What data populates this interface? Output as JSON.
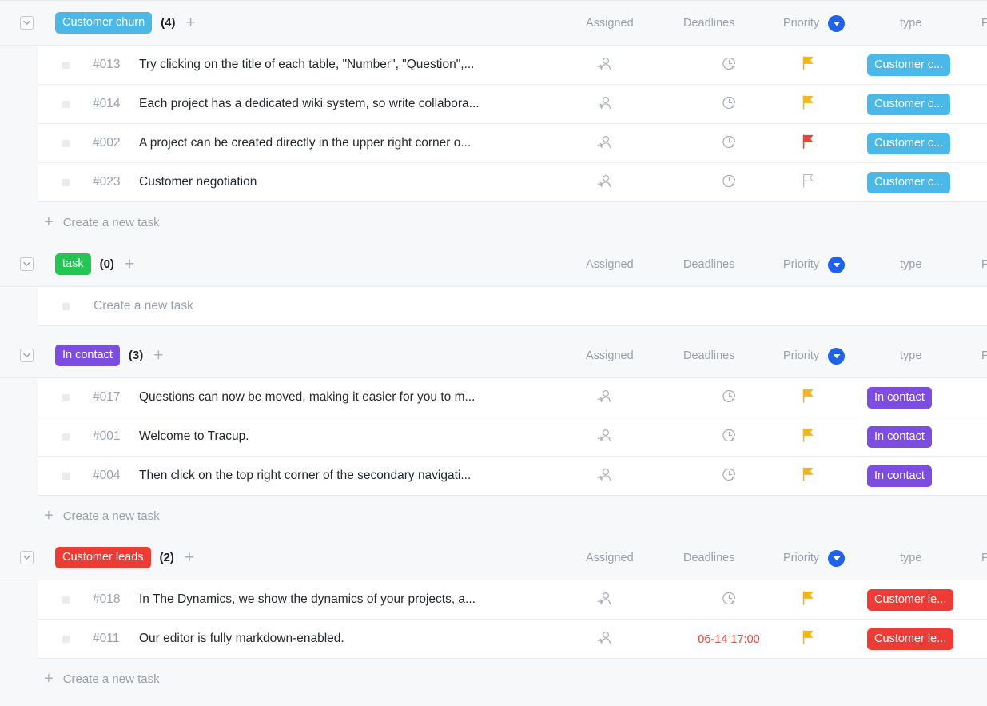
{
  "columns": {
    "assigned": "Assigned",
    "deadlines": "Deadlines",
    "priority": "Priority",
    "type": "type",
    "partial": "Pa"
  },
  "labels": {
    "create_task": "Create a new task",
    "create_task_placeholder": "Create a new task",
    "add_group_task": "+"
  },
  "colors": {
    "customer_churn": "#4cb8e8",
    "task": "#23c653",
    "in_contact": "#7c4dde",
    "customer_leads": "#ef3b36",
    "sort_indicator": "#1f62e8",
    "flag_high": "#efb61e",
    "flag_urgent": "#e8443a",
    "flag_none": "#b9bec8",
    "overdue_text": "#e8443a"
  },
  "groups": [
    {
      "name": "Customer churn",
      "badge_color": "#4cb8e8",
      "count": "(4)",
      "collapsed": false,
      "has_create_row": true,
      "tasks": [
        {
          "id": "#013",
          "title": "Try clicking on the title of each table, \"Number\", \"Question\",...",
          "assigned": "",
          "deadline": "",
          "priority": "high",
          "type": "Customer c..."
        },
        {
          "id": "#014",
          "title": "Each project has a dedicated wiki system, so write collabora...",
          "assigned": "",
          "deadline": "",
          "priority": "high",
          "type": "Customer c..."
        },
        {
          "id": "#002",
          "title": "A project can be created directly in the upper right corner o...",
          "assigned": "",
          "deadline": "",
          "priority": "urgent",
          "type": "Customer c..."
        },
        {
          "id": "#023",
          "title": "Customer negotiation",
          "assigned": "",
          "deadline": "",
          "priority": "none",
          "type": "Customer c..."
        }
      ]
    },
    {
      "name": "task",
      "badge_color": "#23c653",
      "count": "(0)",
      "collapsed": false,
      "has_create_row": false,
      "tasks": []
    },
    {
      "name": "In contact",
      "badge_color": "#7c4dde",
      "count": "(3)",
      "collapsed": false,
      "has_create_row": true,
      "tasks": [
        {
          "id": "#017",
          "title": "Questions can now be moved, making it easier for you to m...",
          "assigned": "",
          "deadline": "",
          "priority": "high",
          "type": "In contact"
        },
        {
          "id": "#001",
          "title": "Welcome to Tracup.",
          "assigned": "",
          "deadline": "",
          "priority": "high",
          "type": "In contact"
        },
        {
          "id": "#004",
          "title": "Then click on the top right corner of the secondary navigati...",
          "assigned": "",
          "deadline": "",
          "priority": "high",
          "type": "In contact"
        }
      ]
    },
    {
      "name": "Customer leads",
      "badge_color": "#ef3b36",
      "count": "(2)",
      "collapsed": false,
      "has_create_row": true,
      "tasks": [
        {
          "id": "#018",
          "title": "In The Dynamics, we show the dynamics of your projects, a...",
          "assigned": "",
          "deadline": "",
          "priority": "high",
          "type": "Customer le..."
        },
        {
          "id": "#011",
          "title": "Our editor is fully markdown-enabled.",
          "assigned": "",
          "deadline": "06-14 17:00",
          "priority": "high",
          "type": "Customer le..."
        }
      ]
    }
  ]
}
